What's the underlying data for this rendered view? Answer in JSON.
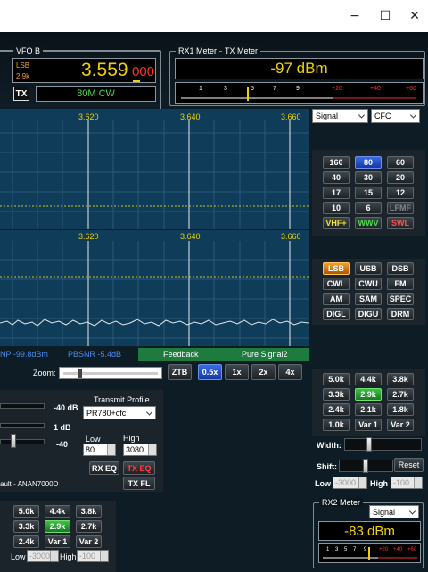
{
  "window": {
    "minimize": "−",
    "maximize": "☐",
    "close": "✕"
  },
  "vfo_b": {
    "label": "VFO B",
    "mode_top": "LSB",
    "mode_bot": "2.9k",
    "freq_main": "3.559",
    "freq_sub": "000",
    "tx": "TX",
    "band_mode": "80M CW"
  },
  "meters": {
    "rx1_label": "RX1 Meter",
    "tx_label": "TX Meter",
    "reading": "-97 dBm",
    "scale": [
      "1",
      "3",
      "5",
      "7",
      "9",
      "+20",
      "+40",
      "+60"
    ]
  },
  "spectrum": {
    "top_freqs": [
      "3.620",
      "3.640",
      "3.660"
    ],
    "bot_freqs": [
      "3.620",
      "3.640",
      "3.660"
    ]
  },
  "display_selects": {
    "mode": "Signal",
    "avg": "CFC"
  },
  "bands": [
    [
      "160",
      "80",
      "60"
    ],
    [
      "40",
      "30",
      "20"
    ],
    [
      "17",
      "15",
      "12"
    ],
    [
      "10",
      "6",
      "LFMF"
    ],
    [
      "VHF+",
      "WWV",
      "SWL"
    ]
  ],
  "modes": [
    [
      "LSB",
      "USB",
      "DSB"
    ],
    [
      "CWL",
      "CWU",
      "FM"
    ],
    [
      "AM",
      "SAM",
      "SPEC"
    ],
    [
      "DIGL",
      "DIGU",
      "DRM"
    ]
  ],
  "status": {
    "np": "NP -99.8dBm",
    "pbsnr": "PBSNR -5.4dB",
    "feedback": "Feedback",
    "pure_signal": "Pure Signal2"
  },
  "zoom": {
    "label": "Zoom:",
    "buttons": [
      "ZTB",
      "0.5x",
      "1x",
      "2x",
      "4x"
    ]
  },
  "tx_panel": {
    "vals": [
      "-40 dB",
      "1 dB",
      "-40"
    ],
    "profile_label": "Transmit Profile",
    "profile": "PR780+cfc",
    "low_label": "Low",
    "high_label": "High",
    "low_val": "80",
    "high_val": "3080",
    "rx_eq": "RX EQ",
    "tx_eq": "TX EQ",
    "tx_fl": "TX FL",
    "default_text": "ault - ANAN7000D"
  },
  "filters_main": [
    [
      "5.0k",
      "4.4k",
      "3.8k"
    ],
    [
      "3.3k",
      "2.9k",
      "2.7k"
    ],
    [
      "2.4k",
      "2.1k",
      "1.8k"
    ],
    [
      "1.0k",
      "Var 1",
      "Var 2"
    ]
  ],
  "filter_ctl": {
    "width": "Width:",
    "shift": "Shift:",
    "reset": "Reset",
    "low": "Low",
    "low_val": "-3000",
    "high": "High",
    "high_val": "-100"
  },
  "filters_rx2": [
    [
      "5.0k",
      "4.4k",
      "3.8k"
    ],
    [
      "3.3k",
      "2.9k",
      "2.7k"
    ],
    [
      "2.4k",
      "Var 1",
      "Var 2"
    ]
  ],
  "rx2_ctl": {
    "low": "Low",
    "low_val": "-3000",
    "high": "High",
    "high_val": "-100"
  },
  "rx2_meter": {
    "label": "RX2 Meter",
    "select": "Signal",
    "reading": "-83 dBm",
    "scale": [
      "1",
      "3",
      "5",
      "7",
      "9",
      "+20",
      "+40",
      "+60"
    ]
  },
  "colors": {
    "accent_blue": "#2a5ed8",
    "select_orange": "#f0a030",
    "select_green": "#2fae38",
    "spectrum_bg": "#0f3c59",
    "freq_text": "#f0d000"
  }
}
